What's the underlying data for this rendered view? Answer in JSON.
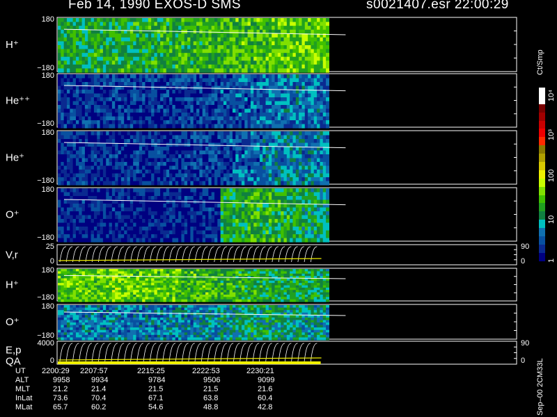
{
  "header": {
    "title": "Feb 14, 1990   EXOS-D SMS",
    "file_time": "s0021407.esr  22:00:29"
  },
  "colorbar": {
    "unit": "Ct/Smp",
    "ticks": [
      "10⁴",
      "10³",
      "100",
      "10",
      "1"
    ],
    "colors": [
      "#ffffff",
      "#ffffff",
      "#7a0000",
      "#a00000",
      "#c80000",
      "#ee0000",
      "#ff2a00",
      "#8a7a00",
      "#b0a000",
      "#d8c800",
      "#f0f000",
      "#c8ff00",
      "#80e000",
      "#40c000",
      "#20a020",
      "#108040",
      "#00c0c0",
      "#1070b0",
      "#0850a0",
      "#0a2a90",
      "#000080"
    ]
  },
  "chart_data": [
    {
      "type": "heatmap",
      "name": "H+ spectrogram (upper)",
      "label": "H⁺",
      "ylim_labels": [
        "180",
        "−180"
      ],
      "fill_fraction": 0.59,
      "profile": [
        0.55,
        0.55,
        0.56,
        0.57,
        0.57,
        0.58,
        0.58,
        0.6,
        0.6,
        0.62,
        0.62,
        0.63,
        0.65,
        0.65,
        0.66,
        0.68,
        0.7,
        0.72,
        0.72,
        0.73
      ],
      "base": "#208020"
    },
    {
      "type": "heatmap",
      "name": "He++ spectrogram",
      "label": "He⁺⁺",
      "ylim_labels": [
        "180",
        "−180"
      ],
      "fill_fraction": 0.59,
      "profile": [
        0.15,
        0.16,
        0.14,
        0.15,
        0.16,
        0.15,
        0.16,
        0.15,
        0.16,
        0.17,
        0.16,
        0.18,
        0.2,
        0.22,
        0.24,
        0.26,
        0.3,
        0.32,
        0.3,
        0.28
      ],
      "base": "#0a2a90"
    },
    {
      "type": "heatmap",
      "name": "He+ spectrogram",
      "label": "He⁺",
      "ylim_labels": [
        "180",
        "−180"
      ],
      "fill_fraction": 0.59,
      "profile": [
        0.12,
        0.12,
        0.12,
        0.13,
        0.12,
        0.13,
        0.13,
        0.14,
        0.14,
        0.15,
        0.16,
        0.18,
        0.2,
        0.23,
        0.26,
        0.3,
        0.34,
        0.36,
        0.35,
        0.32
      ],
      "base": "#0a2a90"
    },
    {
      "type": "heatmap",
      "name": "O+ spectrogram (upper)",
      "label": "O⁺",
      "ylim_labels": [
        "180",
        "−180"
      ],
      "fill_fraction": 0.59,
      "profile": [
        0.1,
        0.1,
        0.1,
        0.1,
        0.1,
        0.1,
        0.1,
        0.1,
        0.1,
        0.1,
        0.1,
        0.12,
        0.55,
        0.6,
        0.62,
        0.6,
        0.58,
        0.55,
        0.5,
        0.48
      ],
      "base": "#0a2a90"
    },
    {
      "type": "line",
      "name": "V,r panel",
      "label": "V,r",
      "left_ticks": [
        "25",
        "0"
      ],
      "right_ticks": [
        "90",
        "0"
      ]
    },
    {
      "type": "heatmap",
      "name": "H+ spectrogram (lower)",
      "label": "H⁺",
      "ylim_labels": [
        "180",
        "−180"
      ],
      "fill_fraction": 0.59,
      "profile": [
        0.7,
        0.72,
        0.7,
        0.72,
        0.74,
        0.7,
        0.72,
        0.7,
        0.68,
        0.66,
        0.65,
        0.63,
        0.62,
        0.6,
        0.58,
        0.56,
        0.55,
        0.55,
        0.54,
        0.52
      ],
      "base": "#40c000"
    },
    {
      "type": "heatmap",
      "name": "O+ spectrogram (lower)",
      "label": "O⁺",
      "ylim_labels": [
        "180",
        "−180"
      ],
      "fill_fraction": 0.59,
      "profile": [
        0.3,
        0.3,
        0.32,
        0.3,
        0.32,
        0.3,
        0.32,
        0.3,
        0.33,
        0.32,
        0.35,
        0.38,
        0.42,
        0.45,
        0.5,
        0.5,
        0.48,
        0.45,
        0.42,
        0.4
      ],
      "base": "#1070b0"
    },
    {
      "type": "line",
      "name": "E,p QA panel",
      "label_top": "E,p",
      "label_bottom": "QA",
      "left_ticks": [
        "4000",
        "0"
      ],
      "right_ticks": [
        "90",
        "0"
      ]
    }
  ],
  "footer": {
    "sideways": "Sep–00  2CM33L",
    "columns": [
      {
        "label": "UT",
        "values": [
          "2200:29",
          "2207:57",
          "2215:25",
          "2222:53",
          "2230:21"
        ]
      },
      {
        "label": "ALT",
        "values": [
          "9958",
          "9934",
          "9784",
          "9506",
          "9099"
        ]
      },
      {
        "label": "MLT",
        "values": [
          "21.2",
          "21.4",
          "21.5",
          "21.5",
          "21.6"
        ]
      },
      {
        "label": "InLat",
        "values": [
          "73.6",
          "70.4",
          "67.1",
          "63.8",
          "60.4"
        ]
      },
      {
        "label": "MLat",
        "values": [
          "65.7",
          "60.2",
          "54.6",
          "48.8",
          "42.8"
        ]
      }
    ]
  }
}
